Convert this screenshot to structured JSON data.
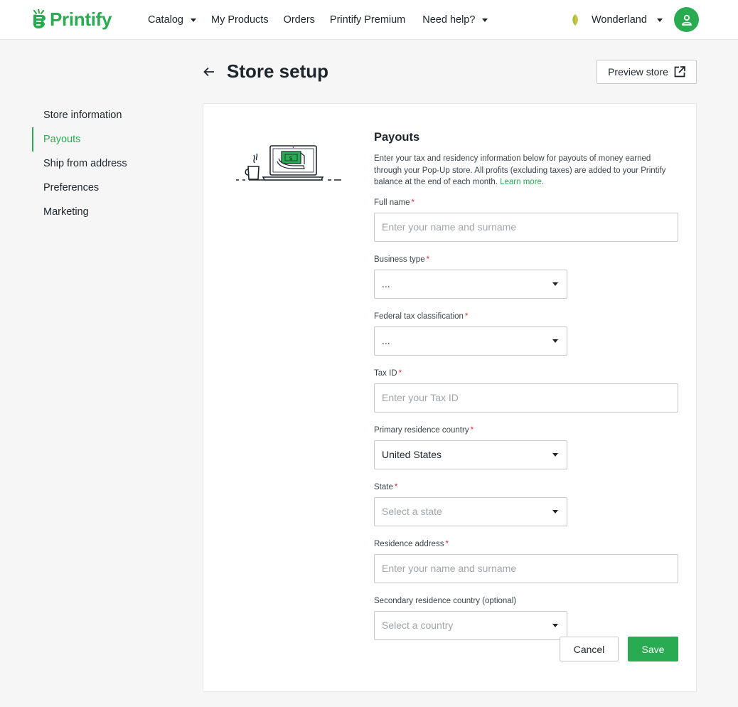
{
  "header": {
    "brand": "Printify",
    "nav": [
      {
        "label": "Catalog",
        "has_caret": true
      },
      {
        "label": "My Products",
        "has_caret": false
      },
      {
        "label": "Orders",
        "has_caret": false
      },
      {
        "label": "Printify Premium",
        "has_caret": false
      },
      {
        "label": "Need help?",
        "has_caret": true
      }
    ],
    "store_name": "Wonderland",
    "icons": {
      "logo": "printify-logo-icon",
      "store": "leaf-icon",
      "avatar": "user-icon"
    }
  },
  "page": {
    "title": "Store setup",
    "preview_label": "Preview store"
  },
  "sidebar": {
    "items": [
      {
        "label": "Store information",
        "active": false
      },
      {
        "label": "Payouts",
        "active": true
      },
      {
        "label": "Ship from address",
        "active": false
      },
      {
        "label": "Preferences",
        "active": false
      },
      {
        "label": "Marketing",
        "active": false
      }
    ]
  },
  "form": {
    "title": "Payouts",
    "description": "Enter your tax and residency information below for payouts of money earned through your Pop-Up store. All profits (excluding taxes) are added to your Printify balance at the end of each month.",
    "learn_more": "Learn more",
    "fields": {
      "full_name": {
        "label": "Full name",
        "placeholder": "Enter your name and surname"
      },
      "business_type": {
        "label": "Business type",
        "value": "..."
      },
      "federal_tax": {
        "label": "Federal tax classification",
        "value": "..."
      },
      "tax_id": {
        "label": "Tax ID",
        "placeholder": "Enter your Tax ID"
      },
      "primary_country": {
        "label": "Primary residence country",
        "value": "United States"
      },
      "state": {
        "label": "State",
        "placeholder": "Select a state"
      },
      "residence_address": {
        "label": "Residence address",
        "placeholder": "Enter your name and surname"
      },
      "secondary_country": {
        "label": "Secondary residence country (optional)",
        "placeholder": "Select a country"
      }
    },
    "cancel_label": "Cancel",
    "save_label": "Save"
  },
  "colors": {
    "brand_green": "#29ab51",
    "required_red": "#e03535",
    "text": "#1d252c"
  }
}
